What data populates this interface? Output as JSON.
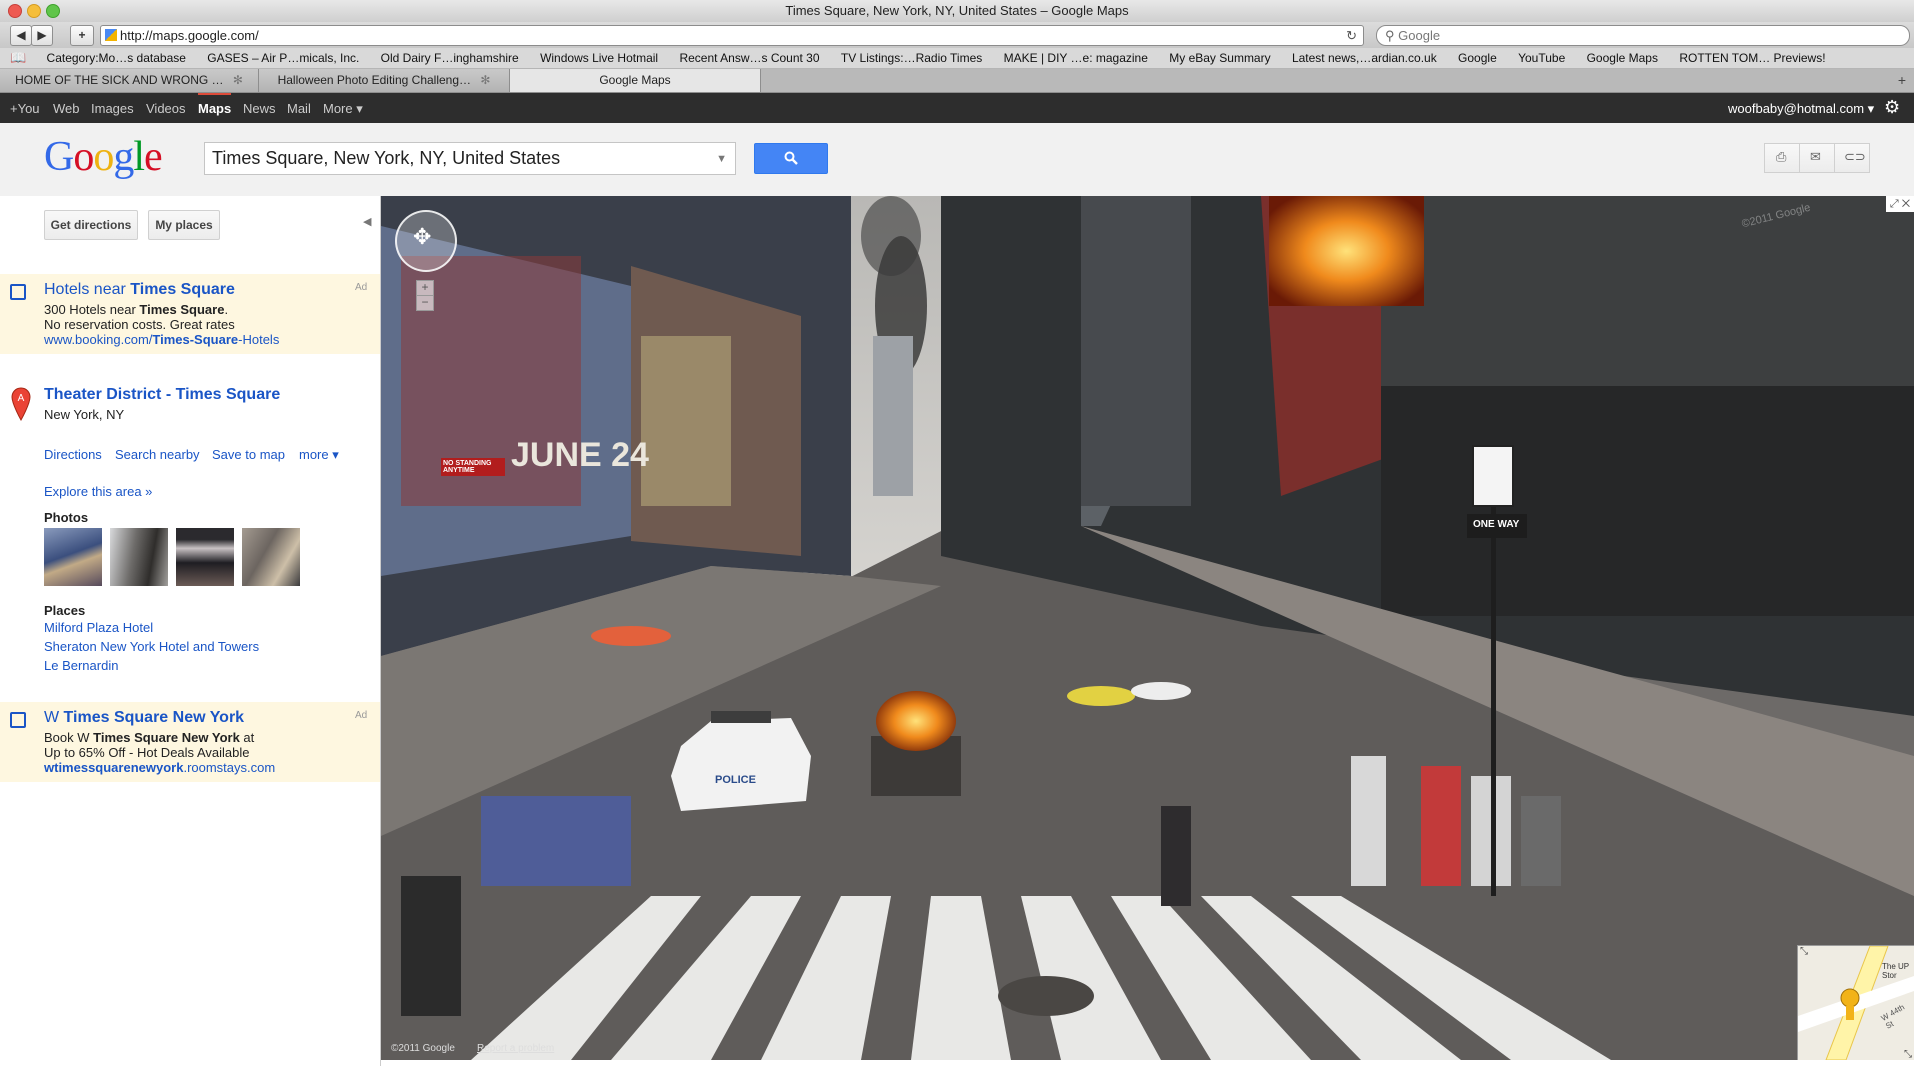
{
  "window": {
    "title": "Times Square, New York, NY, United States – Google Maps"
  },
  "browser": {
    "url": "http://maps.google.com/",
    "search_placeholder": "Google",
    "bookmarks": [
      "Category:Mo…s database",
      "GASES – Air P…micals, Inc.",
      "Old Dairy F…inghamshire",
      "Windows Live Hotmail",
      "Recent Answ…s Count 30",
      "TV Listings:…Radio Times",
      "MAKE | DIY …e: magazine",
      "My eBay Summary",
      "Latest news,…ardian.co.uk",
      "Google",
      "YouTube",
      "Google Maps",
      "ROTTEN TOM… Previews!"
    ],
    "tabs": [
      {
        "label": "HOME OF THE SICK AND WRONG …"
      },
      {
        "label": "Halloween Photo Editing Challeng…"
      },
      {
        "label": "Google Maps"
      }
    ]
  },
  "gbar": {
    "links": [
      "+You",
      "Web",
      "Images",
      "Videos",
      "Maps",
      "News",
      "Mail",
      "More ▾"
    ],
    "account": "woofbaby@hotmal.com ▾"
  },
  "search": {
    "value": "Times Square, New York, NY, United States"
  },
  "left": {
    "get_directions": "Get directions",
    "my_places": "My places",
    "ad1": {
      "title_pre": "Hotels near ",
      "title_bold": "Times Square",
      "line1_pre": "300 Hotels near ",
      "line1_bold": "Times Square",
      "line1_post": ".",
      "line2": "No reservation costs. Great rates",
      "url_pre": "www.booking.com/",
      "url_bold": "Times-Square",
      "url_post": "-Hotels",
      "tag": "Ad"
    },
    "result": {
      "marker": "A",
      "title": "Theater District - Times Square",
      "address": "New York, NY",
      "actions": [
        "Directions",
        "Search nearby",
        "Save to map",
        "more ▾"
      ],
      "explore": "Explore this area »",
      "photos_heading": "Photos",
      "places_heading": "Places",
      "places": [
        "Milford Plaza Hotel",
        "Sheraton New York Hotel and Towers",
        "Le Bernardin"
      ]
    },
    "ad2": {
      "title_pre": "W ",
      "title_bold": "Times Square New York",
      "line1_pre": "Book W ",
      "line1_bold": "Times Square New York",
      "line1_post": " at",
      "line2": "Up to 65% Off - Hot Deals Available",
      "url_bold": "wtimessquarenewyork",
      "url_post": ".roomstays.com",
      "tag": "Ad"
    }
  },
  "streetview": {
    "billboard_text": "JUNE 24",
    "police_text": "POLICE",
    "sign_one_way": "ONE WAY",
    "sign_no_standing": "NO STANDING ANYTIME",
    "copyright": "©2011 Google",
    "report": "Report a problem",
    "watermark": "©2011 Google",
    "minimap_label": "The UP Stor",
    "minimap_street": "W 44th St"
  }
}
